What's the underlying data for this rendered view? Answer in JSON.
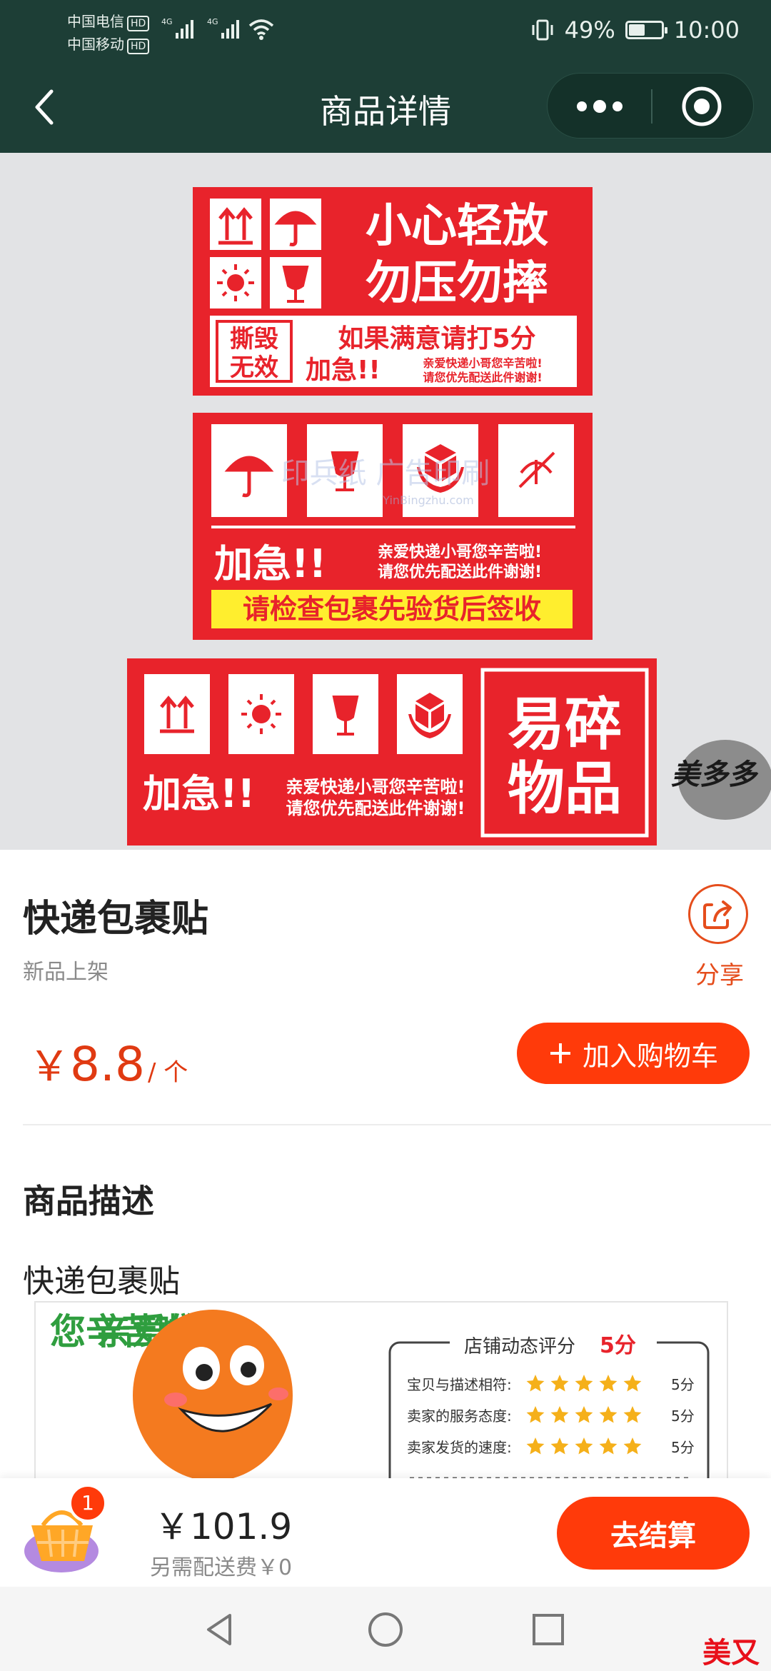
{
  "status_bar": {
    "carrier1": "中国电信",
    "carrier2": "中国移动",
    "hd": "HD",
    "net1": "4G",
    "net2": "4G",
    "battery": "49%",
    "battery_level": 0.49,
    "time": "10:00"
  },
  "nav": {
    "title": "商品详情",
    "back_icon": "chevron-left-icon",
    "more_icon": "more-dots-icon",
    "close_icon": "target-icon"
  },
  "product_image": {
    "card1": {
      "title_line1": "小心轻放",
      "title_line2": "勿压勿摔",
      "tear_line1": "撕毁",
      "tear_line2": "无效",
      "rate": "如果满意请打5分",
      "urgent": "加急!!",
      "thanks_line1": "亲爱快递小哥您辛苦啦!",
      "thanks_line2": "请您优先配送此件谢谢!"
    },
    "card2": {
      "watermark": "印兵纸 广告印刷",
      "watermark_url": "YinBingzhu.com",
      "urgent": "加急!!",
      "thanks_line1": "亲爱快递小哥您辛苦啦!",
      "thanks_line2": "请您优先配送此件谢谢!",
      "check": "请检查包裹先验货后签收"
    },
    "card3": {
      "urgent": "加急!!",
      "thanks_line1": "亲爱快递小哥您辛苦啦!",
      "thanks_line2": "请您优先配送此件谢谢!",
      "fragile_line1": "易碎",
      "fragile_line2": "物品"
    },
    "logo_text": "美多多"
  },
  "product": {
    "name": "快递包裹贴",
    "tag": "新品上架",
    "share_label": "分享",
    "price_currency": "￥",
    "price": "8.8",
    "unit": "/ 个",
    "add_to_cart": "加入购物车"
  },
  "description": {
    "heading": "商品描述",
    "text": "快递包裹贴",
    "image": {
      "side_col1": "您辛苦啦",
      "side_col2": "亲爱的快",
      "panel_title": "店铺动态评分",
      "panel_score": "5分",
      "rows": [
        {
          "label": "宝贝与描述相符:",
          "score": "5分"
        },
        {
          "label": "卖家的服务态度:",
          "score": "5分"
        },
        {
          "label": "卖家发货的速度:",
          "score": "5分"
        }
      ]
    }
  },
  "cart": {
    "badge": "1",
    "total": "￥101.9",
    "fee": "另需配送费￥0",
    "checkout": "去结算"
  },
  "watermark": "美又多",
  "colors": {
    "header": "#1d3e36",
    "accent": "#ff3a0a",
    "price": "#e03a12",
    "sticker_red": "#e8232b"
  }
}
